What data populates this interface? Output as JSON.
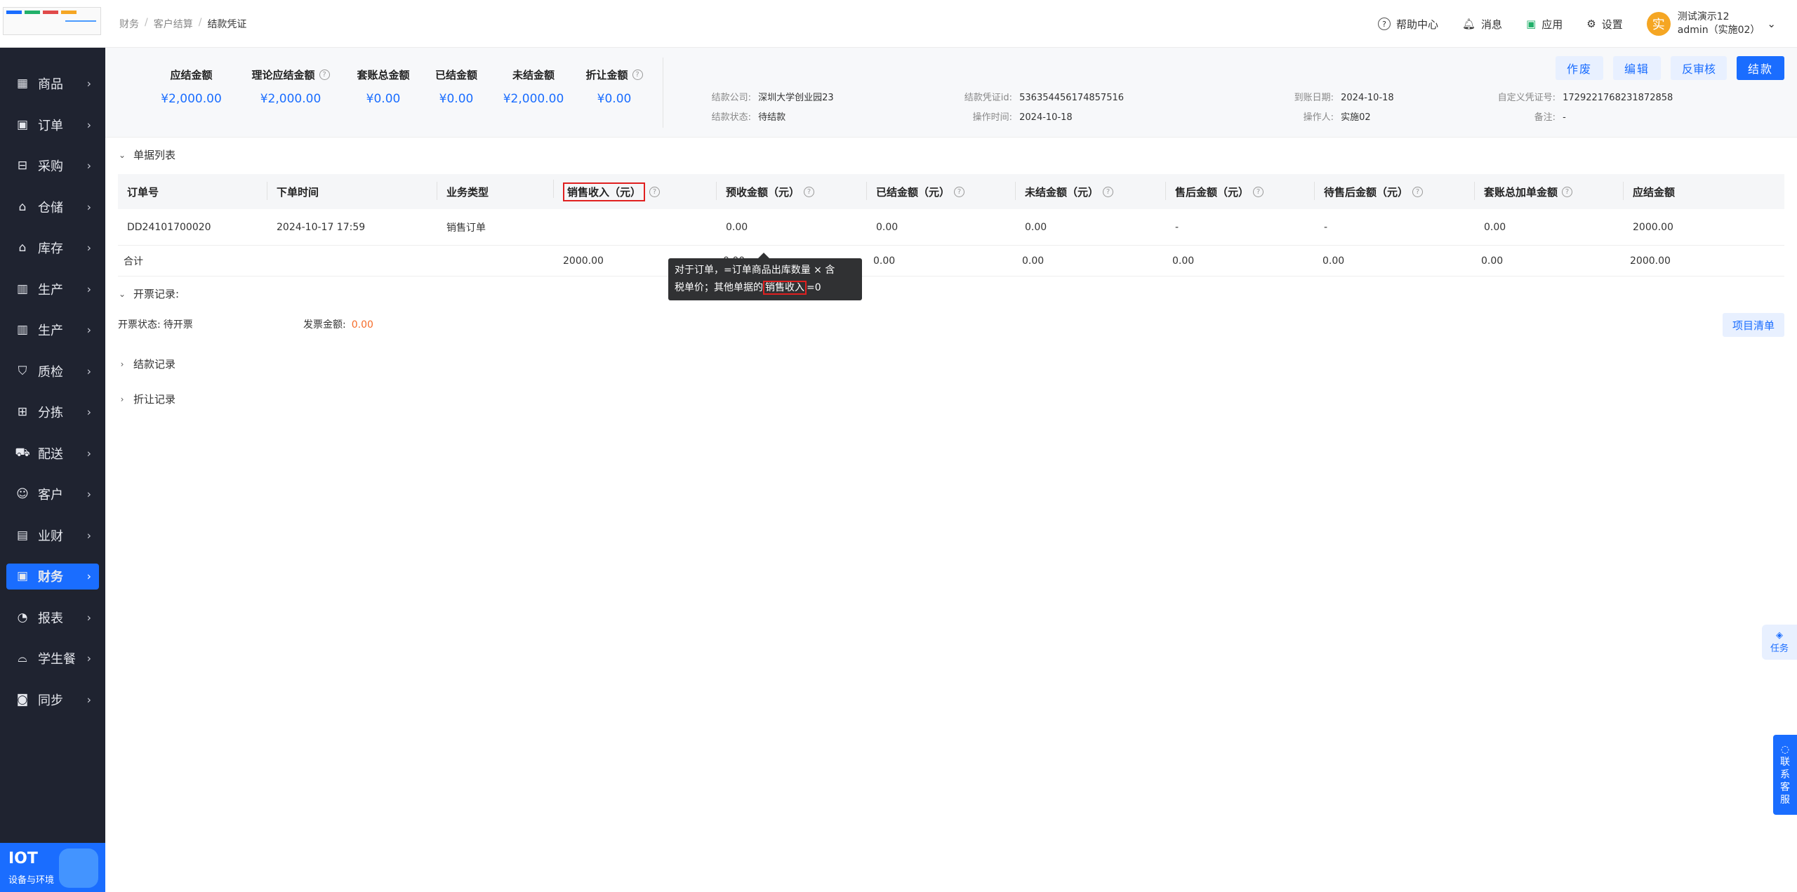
{
  "breadcrumb": [
    "财务",
    "客户结算",
    "结款凭证"
  ],
  "topbar": {
    "help": "帮助中心",
    "messages": "消息",
    "apps": "应用",
    "settings": "设置",
    "user_name": "测试演示12",
    "user_role": "admin（实施02）",
    "avatar_char": "实"
  },
  "sidebar": {
    "items": [
      {
        "label": "商品",
        "icon": "grid-icon"
      },
      {
        "label": "订单",
        "icon": "clipboard-icon"
      },
      {
        "label": "采购",
        "icon": "basket-icon"
      },
      {
        "label": "仓储",
        "icon": "warehouse-icon"
      },
      {
        "label": "库存",
        "icon": "inventory-icon"
      },
      {
        "label": "生产",
        "icon": "factory-icon"
      },
      {
        "label": "生产",
        "icon": "factory-icon"
      },
      {
        "label": "质检",
        "icon": "shield-icon"
      },
      {
        "label": "分拣",
        "icon": "sort-icon"
      },
      {
        "label": "配送",
        "icon": "truck-icon"
      },
      {
        "label": "客户",
        "icon": "user-icon"
      },
      {
        "label": "业财",
        "icon": "ledger-icon"
      },
      {
        "label": "财务",
        "icon": "finance-icon",
        "active": true
      },
      {
        "label": "报表",
        "icon": "chart-clock-icon"
      },
      {
        "label": "学生餐",
        "icon": "meal-icon"
      },
      {
        "label": "同步",
        "icon": "sync-icon"
      }
    ],
    "footer_title": "IOT",
    "footer_sub": "设备与环境"
  },
  "summary": {
    "metrics": [
      {
        "label": "应结金额",
        "value": "¥2,000.00",
        "help": false
      },
      {
        "label": "理论应结金额",
        "value": "¥2,000.00",
        "help": true
      },
      {
        "label": "套账总金额",
        "value": "¥0.00",
        "help": false
      },
      {
        "label": "已结金额",
        "value": "¥0.00",
        "help": false
      },
      {
        "label": "未结金额",
        "value": "¥2,000.00",
        "help": false
      },
      {
        "label": "折让金额",
        "value": "¥0.00",
        "help": true
      }
    ],
    "info": {
      "company_label": "结款公司:",
      "company": "深圳大学创业园23",
      "status_label": "结款状态:",
      "status": "待结款",
      "voucher_id_label": "结款凭证id:",
      "voucher_id": "536354456174857516",
      "op_time_label": "操作时间:",
      "op_time": "2024-10-18",
      "arrive_label": "到账日期:",
      "arrive": "2024-10-18",
      "operator_label": "操作人:",
      "operator": "实施02",
      "custom_label": "自定义凭证号:",
      "custom": "1729221768231872858",
      "remark_label": "备注:",
      "remark": "-"
    },
    "buttons": {
      "void": "作废",
      "edit": "编辑",
      "unapprove": "反审核",
      "settle": "结款"
    }
  },
  "sections": {
    "doc_list": "单据列表",
    "invoice": "开票记录:",
    "settle_records": "结款记录",
    "discount_records": "折让记录"
  },
  "table": {
    "headers": [
      "订单号",
      "下单时间",
      "业务类型",
      "销售收入（元）",
      "预收金额（元）",
      "已结金额（元）",
      "未结金额（元）",
      "售后金额（元）",
      "待售后金额（元）",
      "套账总加单金额",
      "应结金额"
    ],
    "rows": [
      [
        "DD24101700020",
        "2024-10-17 17:59",
        "销售订单",
        "",
        "0.00",
        "0.00",
        "0.00",
        "-",
        "-",
        "0.00",
        "2000.00"
      ]
    ],
    "total_label": "合计",
    "totals": [
      "2000.00",
      "0.00",
      "0.00",
      "0.00",
      "0.00",
      "0.00",
      "0.00",
      "2000.00"
    ]
  },
  "tooltip": {
    "line1": "对于订单，=订单商品出库数量 × 含",
    "line2a": "税单价；其他单据的",
    "line2b": "销售收入",
    "line2c": "=0"
  },
  "invoice": {
    "status_label": "开票状态:",
    "status": "待开票",
    "amount_label": "发票金额:",
    "amount": "0.00",
    "list_button": "项目清单"
  },
  "floats": {
    "task": "任务",
    "service": [
      "联",
      "系",
      "客",
      "服"
    ]
  },
  "colors": {
    "primary": "#1a6dff",
    "sidebar": "#1f2330",
    "highlight": "#e02020",
    "amount_orange": "#f56c2a"
  }
}
